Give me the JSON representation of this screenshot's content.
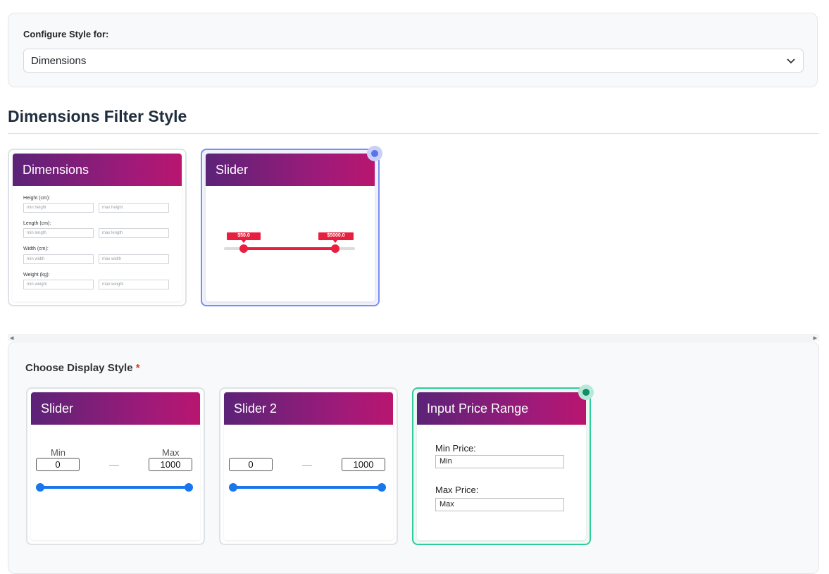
{
  "config": {
    "label": "Configure Style for:",
    "selected": "Dimensions"
  },
  "section": {
    "title": "Dimensions Filter Style"
  },
  "filter_styles": [
    {
      "title": "Dimensions",
      "rows": [
        {
          "label": "Height (cm):",
          "min": "min height",
          "max": "max height"
        },
        {
          "label": "Length (cm):",
          "min": "min length",
          "max": "max length"
        },
        {
          "label": "Width (cm):",
          "min": "min width",
          "max": "max width"
        },
        {
          "label": "Weight (kg):",
          "min": "min weight",
          "max": "max weight"
        }
      ]
    },
    {
      "title": "Slider",
      "min_tag": "$50.0",
      "max_tag": "$5000.0",
      "selected": true
    }
  ],
  "display": {
    "label": "Choose Display Style",
    "required_mark": "*",
    "cards": [
      {
        "title": "Slider",
        "min_label": "Min",
        "max_label": "Max",
        "min_value": "0",
        "max_value": "1000"
      },
      {
        "title": "Slider 2",
        "min_value": "0",
        "max_value": "1000"
      },
      {
        "title": "Input Price Range",
        "min_label": "Min Price:",
        "min_value": "Min",
        "max_label": "Max Price:",
        "max_value": "Max",
        "selected": true
      }
    ]
  },
  "colors": {
    "accent_blue": "#7b8ef2",
    "accent_green": "#2ecc9a",
    "header_gradient_start": "#5b2378",
    "header_gradient_end": "#b8166f",
    "slider_red": "#e8203f",
    "slider_blue": "#1976ed"
  }
}
